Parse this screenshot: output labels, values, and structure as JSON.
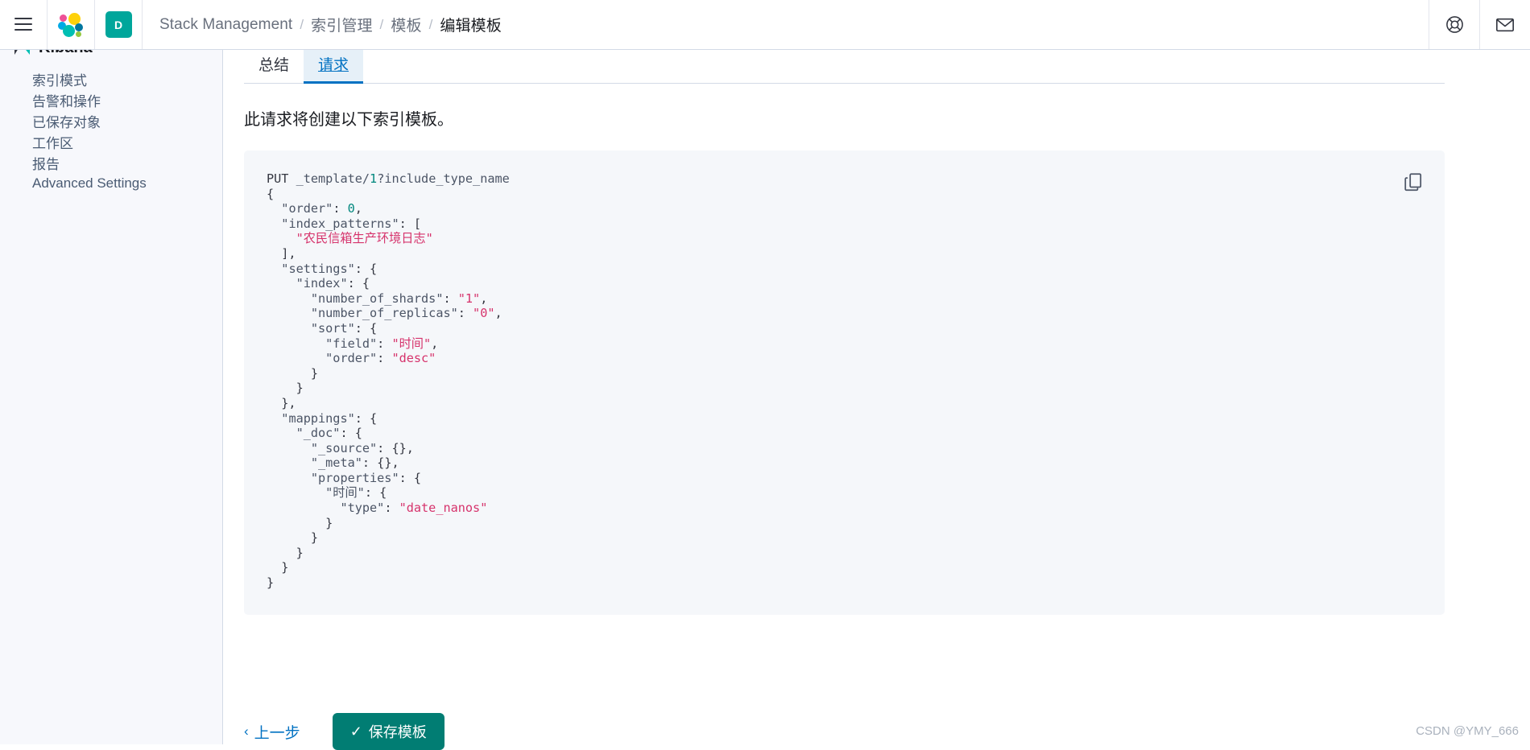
{
  "header": {
    "menu_icon": "hamburger-menu-icon",
    "logo_icon": "elastic-logo-icon",
    "space_badge": "D",
    "breadcrumbs": [
      {
        "label": "Stack Management",
        "current": false
      },
      {
        "label": "索引管理",
        "current": false
      },
      {
        "label": "模板",
        "current": false
      },
      {
        "label": "编辑模板",
        "current": true
      }
    ],
    "separator": "/",
    "help_icon": "lifebuoy-help-icon",
    "mail_icon": "mail-envelope-icon"
  },
  "sidebar": {
    "title": "Kibana",
    "items": [
      {
        "label": "索引模式"
      },
      {
        "label": "告警和操作"
      },
      {
        "label": "已保存对象"
      },
      {
        "label": "工作区"
      },
      {
        "label": "报告"
      },
      {
        "label": "Advanced Settings"
      }
    ]
  },
  "main": {
    "tabs": [
      {
        "label": "总结",
        "active": false
      },
      {
        "label": "请求",
        "active": true
      }
    ],
    "intro_text": "此请求将创建以下索引模板。",
    "copy_icon": "copy-to-clipboard-icon",
    "code": {
      "method": "PUT",
      "endpoint": "_template/1?include_type_name",
      "endpoint_number": "1",
      "lines": [
        "PUT _template/1?include_type_name",
        "{",
        "  \"order\": 0,",
        "  \"index_patterns\": [",
        "    \"农民信箱生产环境日志\"",
        "  ],",
        "  \"settings\": {",
        "    \"index\": {",
        "      \"number_of_shards\": \"1\",",
        "      \"number_of_replicas\": \"0\",",
        "      \"sort\": {",
        "        \"field\": \"时间\",",
        "        \"order\": \"desc\"",
        "      }",
        "    }",
        "  },",
        "  \"mappings\": {",
        "    \"_doc\": {",
        "      \"_source\": {},",
        "      \"_meta\": {},",
        "      \"properties\": {",
        "        \"时间\": {",
        "          \"type\": \"date_nanos\"",
        "        }",
        "      }",
        "    }",
        "  }",
        "}"
      ]
    }
  },
  "footer": {
    "back_label": "上一步",
    "back_chevron": "‹",
    "submit_label": "保存模板",
    "submit_check": "✓"
  },
  "watermark": "CSDN @YMY_666",
  "colors": {
    "accent_blue": "#0071c2",
    "primary_teal": "#017d73",
    "space_badge": "#00a69b",
    "string_pink": "#d6336c",
    "number_teal": "#00877d",
    "code_bg": "#f5f7fa",
    "sidebar_bg": "#f7f8fc"
  }
}
